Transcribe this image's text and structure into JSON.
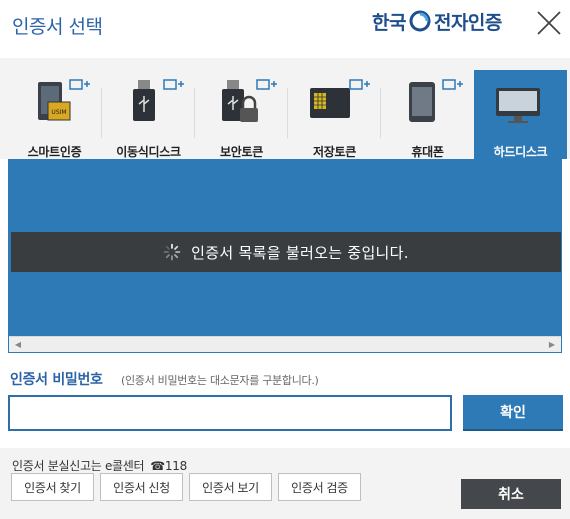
{
  "dialog": {
    "title": "인증서 선택",
    "brand_pre": "한국",
    "brand_post": "전자인증"
  },
  "tabs": [
    {
      "label": "스마트인증",
      "icon": "smart-auth-icon",
      "active": false
    },
    {
      "label": "이동식디스크",
      "icon": "usb-drive-icon",
      "active": false
    },
    {
      "label": "보안토큰",
      "icon": "security-token-icon",
      "active": false
    },
    {
      "label": "저장토큰",
      "icon": "storage-token-icon",
      "active": false
    },
    {
      "label": "휴대폰",
      "icon": "mobile-phone-icon",
      "active": false
    },
    {
      "label": "하드디스크",
      "icon": "hard-disk-icon",
      "active": true
    }
  ],
  "cert_list": {
    "loading_message": "인증서 목록을 불러오는 중입니다."
  },
  "password": {
    "label": "인증서 비밀번호",
    "hint": "(인증서 비밀번호는 대소문자를 구분합니다.)",
    "value": "",
    "confirm_label": "확인"
  },
  "footer": {
    "lost_text": "인증서 분실신고는 e콜센터",
    "phone_symbol": "☎",
    "phone_number": "118",
    "buttons": [
      "인증서 찾기",
      "인증서 신청",
      "인증서 보기",
      "인증서 검증"
    ],
    "cancel_label": "취소"
  },
  "colors": {
    "accent": "#2e7ab7",
    "title": "#2b63a8",
    "loading_bg": "#3a3d40",
    "cancel_bg": "#44484c"
  }
}
